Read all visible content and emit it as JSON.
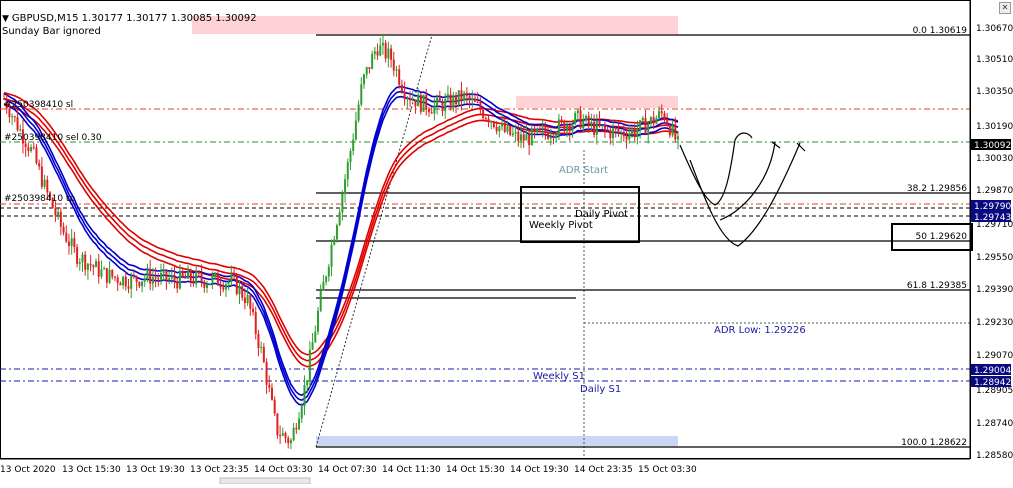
{
  "header": {
    "symbol_info": "GBPUSD,M15  1.30177 1.30177 1.30085 1.30092",
    "subtitle": "Sunday Bar ignored"
  },
  "colors": {
    "background": "#ffffff",
    "ema_red": "#e00000",
    "ema_blue": "#0000d0",
    "bull_candle": "#2e9e2e",
    "bear_candle": "#e02020",
    "fib_line": "#000000",
    "zone_pink": "#ffd2d6",
    "zone_blue": "#c9d6f5",
    "price_tag": "#0a0a80"
  },
  "icons": [
    "close-icon",
    "arrow-down-icon"
  ],
  "trade_labels": {
    "sell_1": "#250398410 sl",
    "sell_2": "#250398410 sel 0.30",
    "tp": "#250398410 tp"
  },
  "fib_levels": [
    {
      "label": "0.0  1.30619",
      "price": 1.30619
    },
    {
      "label": "38.2  1.29856",
      "price": 1.29856
    },
    {
      "label": "50  1.29620",
      "price": 1.2962
    },
    {
      "label": "61.8  1.29385",
      "price": 1.29385
    },
    {
      "label": "100.0  1.28622",
      "price": 1.28622
    }
  ],
  "annotations": {
    "adr_start": "ADR Start",
    "daily_pivot": "Daily Pivot",
    "weekly_pivot": "Weekly Pivot",
    "adr_low": "ADR Low: 1.29226",
    "weekly_s1": "Weekly S1",
    "daily_s1": "Daily S1"
  },
  "price_axis": {
    "ticks": [
      "1.30670",
      "1.30510",
      "1.30350",
      "1.30190",
      "1.30030",
      "1.29870",
      "1.29710",
      "1.29550",
      "1.29390",
      "1.29230",
      "1.29070",
      "1.28905",
      "1.28740",
      "1.28580"
    ],
    "current_price": "1.30092",
    "tags": [
      {
        "label": "1.29790",
        "price": 1.2979
      },
      {
        "label": "1.29743",
        "price": 1.29743
      },
      {
        "label": "1.29004",
        "price": 1.29004
      },
      {
        "label": "1.28942",
        "price": 1.28942
      }
    ]
  },
  "time_axis": {
    "ticks": [
      "13 Oct 2020",
      "13 Oct 15:30",
      "13 Oct 19:30",
      "13 Oct 23:35",
      "14 Oct 03:30",
      "14 Oct 07:30",
      "14 Oct 11:30",
      "14 Oct 15:30",
      "14 Oct 19:30",
      "14 Oct 23:35",
      "15 Oct 03:30"
    ]
  },
  "chart_data": {
    "type": "candlestick",
    "symbol": "GBPUSD",
    "timeframe": "M15",
    "ylim": [
      1.2858,
      1.3067
    ],
    "x": [
      "13 Oct 2020",
      "13 Oct 15:30",
      "13 Oct 19:30",
      "13 Oct 23:35",
      "14 Oct 03:30",
      "14 Oct 07:30",
      "14 Oct 11:30",
      "14 Oct 15:30",
      "14 Oct 19:30",
      "14 Oct 23:35",
      "15 Oct 03:30"
    ],
    "close_path": [
      1.3032,
      1.3018,
      1.3005,
      1.2985,
      1.2968,
      1.2955,
      1.295,
      1.2945,
      1.2943,
      1.2942,
      1.2944,
      1.2943,
      1.2942,
      1.2943,
      1.2942,
      1.2942,
      1.2941,
      1.2932,
      1.2905,
      1.2868,
      1.2862,
      1.289,
      1.293,
      1.2965,
      1.3,
      1.304,
      1.3058,
      1.3052,
      1.3035,
      1.303,
      1.3028,
      1.303,
      1.3033,
      1.3028,
      1.3022,
      1.3015,
      1.3012,
      1.3013,
      1.3016,
      1.3019,
      1.3022,
      1.3018,
      1.3016,
      1.3015,
      1.3016,
      1.302,
      1.3025,
      1.3009
    ],
    "last_price": 1.30092
  }
}
